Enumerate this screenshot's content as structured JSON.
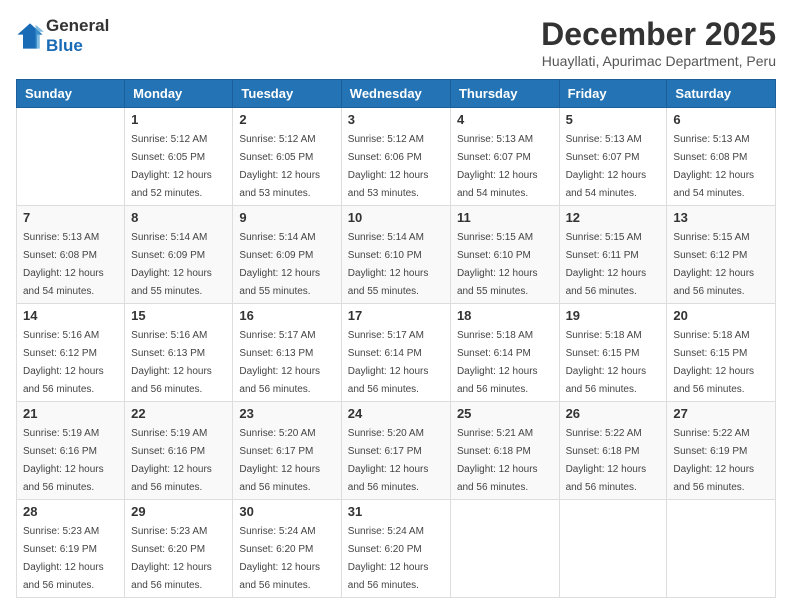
{
  "logo": {
    "general": "General",
    "blue": "Blue"
  },
  "header": {
    "month": "December 2025",
    "location": "Huayllati, Apurimac Department, Peru"
  },
  "weekdays": [
    "Sunday",
    "Monday",
    "Tuesday",
    "Wednesday",
    "Thursday",
    "Friday",
    "Saturday"
  ],
  "weeks": [
    [
      {
        "day": "",
        "sunrise": "",
        "sunset": "",
        "daylight": ""
      },
      {
        "day": "1",
        "sunrise": "Sunrise: 5:12 AM",
        "sunset": "Sunset: 6:05 PM",
        "daylight": "Daylight: 12 hours and 52 minutes."
      },
      {
        "day": "2",
        "sunrise": "Sunrise: 5:12 AM",
        "sunset": "Sunset: 6:05 PM",
        "daylight": "Daylight: 12 hours and 53 minutes."
      },
      {
        "day": "3",
        "sunrise": "Sunrise: 5:12 AM",
        "sunset": "Sunset: 6:06 PM",
        "daylight": "Daylight: 12 hours and 53 minutes."
      },
      {
        "day": "4",
        "sunrise": "Sunrise: 5:13 AM",
        "sunset": "Sunset: 6:07 PM",
        "daylight": "Daylight: 12 hours and 54 minutes."
      },
      {
        "day": "5",
        "sunrise": "Sunrise: 5:13 AM",
        "sunset": "Sunset: 6:07 PM",
        "daylight": "Daylight: 12 hours and 54 minutes."
      },
      {
        "day": "6",
        "sunrise": "Sunrise: 5:13 AM",
        "sunset": "Sunset: 6:08 PM",
        "daylight": "Daylight: 12 hours and 54 minutes."
      }
    ],
    [
      {
        "day": "7",
        "sunrise": "Sunrise: 5:13 AM",
        "sunset": "Sunset: 6:08 PM",
        "daylight": "Daylight: 12 hours and 54 minutes."
      },
      {
        "day": "8",
        "sunrise": "Sunrise: 5:14 AM",
        "sunset": "Sunset: 6:09 PM",
        "daylight": "Daylight: 12 hours and 55 minutes."
      },
      {
        "day": "9",
        "sunrise": "Sunrise: 5:14 AM",
        "sunset": "Sunset: 6:09 PM",
        "daylight": "Daylight: 12 hours and 55 minutes."
      },
      {
        "day": "10",
        "sunrise": "Sunrise: 5:14 AM",
        "sunset": "Sunset: 6:10 PM",
        "daylight": "Daylight: 12 hours and 55 minutes."
      },
      {
        "day": "11",
        "sunrise": "Sunrise: 5:15 AM",
        "sunset": "Sunset: 6:10 PM",
        "daylight": "Daylight: 12 hours and 55 minutes."
      },
      {
        "day": "12",
        "sunrise": "Sunrise: 5:15 AM",
        "sunset": "Sunset: 6:11 PM",
        "daylight": "Daylight: 12 hours and 56 minutes."
      },
      {
        "day": "13",
        "sunrise": "Sunrise: 5:15 AM",
        "sunset": "Sunset: 6:12 PM",
        "daylight": "Daylight: 12 hours and 56 minutes."
      }
    ],
    [
      {
        "day": "14",
        "sunrise": "Sunrise: 5:16 AM",
        "sunset": "Sunset: 6:12 PM",
        "daylight": "Daylight: 12 hours and 56 minutes."
      },
      {
        "day": "15",
        "sunrise": "Sunrise: 5:16 AM",
        "sunset": "Sunset: 6:13 PM",
        "daylight": "Daylight: 12 hours and 56 minutes."
      },
      {
        "day": "16",
        "sunrise": "Sunrise: 5:17 AM",
        "sunset": "Sunset: 6:13 PM",
        "daylight": "Daylight: 12 hours and 56 minutes."
      },
      {
        "day": "17",
        "sunrise": "Sunrise: 5:17 AM",
        "sunset": "Sunset: 6:14 PM",
        "daylight": "Daylight: 12 hours and 56 minutes."
      },
      {
        "day": "18",
        "sunrise": "Sunrise: 5:18 AM",
        "sunset": "Sunset: 6:14 PM",
        "daylight": "Daylight: 12 hours and 56 minutes."
      },
      {
        "day": "19",
        "sunrise": "Sunrise: 5:18 AM",
        "sunset": "Sunset: 6:15 PM",
        "daylight": "Daylight: 12 hours and 56 minutes."
      },
      {
        "day": "20",
        "sunrise": "Sunrise: 5:18 AM",
        "sunset": "Sunset: 6:15 PM",
        "daylight": "Daylight: 12 hours and 56 minutes."
      }
    ],
    [
      {
        "day": "21",
        "sunrise": "Sunrise: 5:19 AM",
        "sunset": "Sunset: 6:16 PM",
        "daylight": "Daylight: 12 hours and 56 minutes."
      },
      {
        "day": "22",
        "sunrise": "Sunrise: 5:19 AM",
        "sunset": "Sunset: 6:16 PM",
        "daylight": "Daylight: 12 hours and 56 minutes."
      },
      {
        "day": "23",
        "sunrise": "Sunrise: 5:20 AM",
        "sunset": "Sunset: 6:17 PM",
        "daylight": "Daylight: 12 hours and 56 minutes."
      },
      {
        "day": "24",
        "sunrise": "Sunrise: 5:20 AM",
        "sunset": "Sunset: 6:17 PM",
        "daylight": "Daylight: 12 hours and 56 minutes."
      },
      {
        "day": "25",
        "sunrise": "Sunrise: 5:21 AM",
        "sunset": "Sunset: 6:18 PM",
        "daylight": "Daylight: 12 hours and 56 minutes."
      },
      {
        "day": "26",
        "sunrise": "Sunrise: 5:22 AM",
        "sunset": "Sunset: 6:18 PM",
        "daylight": "Daylight: 12 hours and 56 minutes."
      },
      {
        "day": "27",
        "sunrise": "Sunrise: 5:22 AM",
        "sunset": "Sunset: 6:19 PM",
        "daylight": "Daylight: 12 hours and 56 minutes."
      }
    ],
    [
      {
        "day": "28",
        "sunrise": "Sunrise: 5:23 AM",
        "sunset": "Sunset: 6:19 PM",
        "daylight": "Daylight: 12 hours and 56 minutes."
      },
      {
        "day": "29",
        "sunrise": "Sunrise: 5:23 AM",
        "sunset": "Sunset: 6:20 PM",
        "daylight": "Daylight: 12 hours and 56 minutes."
      },
      {
        "day": "30",
        "sunrise": "Sunrise: 5:24 AM",
        "sunset": "Sunset: 6:20 PM",
        "daylight": "Daylight: 12 hours and 56 minutes."
      },
      {
        "day": "31",
        "sunrise": "Sunrise: 5:24 AM",
        "sunset": "Sunset: 6:20 PM",
        "daylight": "Daylight: 12 hours and 56 minutes."
      },
      {
        "day": "",
        "sunrise": "",
        "sunset": "",
        "daylight": ""
      },
      {
        "day": "",
        "sunrise": "",
        "sunset": "",
        "daylight": ""
      },
      {
        "day": "",
        "sunrise": "",
        "sunset": "",
        "daylight": ""
      }
    ]
  ]
}
